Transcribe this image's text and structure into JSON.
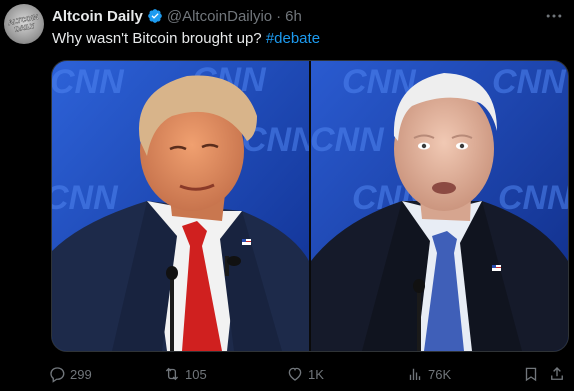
{
  "tweet": {
    "author": {
      "display_name": "Altcoin Daily",
      "handle": "@AltcoinDailyio",
      "separator": "·",
      "time": "6h",
      "avatar_text": "ALTCOIN DAILY",
      "verified_color": "#1d9bf0"
    },
    "text": "Why wasn't Bitcoin brought up? ",
    "hashtag": "#debate",
    "media": {
      "left_panel": {
        "watermark": "CNN",
        "subject": "candidate-left",
        "tie_color": "#d0201f"
      },
      "right_panel": {
        "watermark": "CNN",
        "subject": "candidate-right",
        "tie_color": "#3f5fb8"
      },
      "background_color": "#1a4bc9"
    },
    "actions": {
      "reply": {
        "icon": "reply-icon",
        "count": "299"
      },
      "repost": {
        "icon": "repost-icon",
        "count": "105"
      },
      "like": {
        "icon": "heart-icon",
        "count": "1K"
      },
      "views": {
        "icon": "views-icon",
        "count": "76K"
      },
      "bookmark": {
        "icon": "bookmark-icon"
      },
      "share": {
        "icon": "share-icon"
      }
    },
    "colors": {
      "background": "#000000",
      "text": "#e7e9ea",
      "muted": "#71767b",
      "link": "#1d9bf0"
    }
  }
}
